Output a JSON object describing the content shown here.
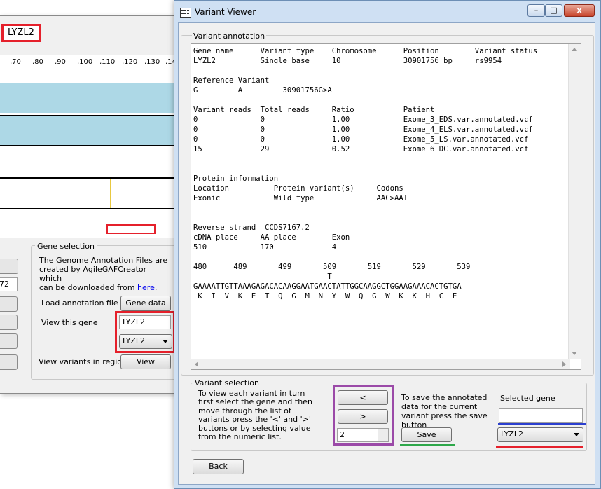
{
  "background_window": {
    "gene_label": "LYZL2",
    "ruler_ticks": [
      ",70",
      ",80",
      ",90",
      ",100",
      ",110",
      ",120",
      ",130",
      ",14"
    ],
    "left_field_value": "72",
    "gene_selection": {
      "title": "Gene selection",
      "info_line1": "The Genome Annotation Files are",
      "info_line2": "created by AgileGAFCreator which",
      "info_line3": "can be downloaded from ",
      "info_link": "here",
      "info_line3_end": ".",
      "load_annotation_label": "Load annotation file",
      "gene_data_button": "Gene data",
      "view_gene_label": "View this gene",
      "gene_text_value": "LYZL2",
      "gene_combo_value": "LYZL2",
      "view_region_label": "View variants in region",
      "view_button": "View"
    }
  },
  "window": {
    "title": "Variant Viewer",
    "minimize": "–",
    "maximize": "□",
    "close": "x"
  },
  "annotation": {
    "group_title": "Variant annotation",
    "lines": [
      "Gene name      Variant type    Chromosome      Position        Variant status",
      "LYZL2          Single base     10              30901756 bp     rs9954",
      "",
      "Reference Variant",
      "G         A         30901756G>A",
      "",
      "Variant reads  Total reads     Ratio           Patient",
      "0              0               1.00            Exome_3_EDS.var.annotated.vcf",
      "0              0               1.00            Exome_4_ELS.var.annotated.vcf",
      "0              0               1.00            Exome_5_LS.var.annotated.vcf",
      "15             29              0.52            Exome_6_DC.var.annotated.vcf",
      "",
      "",
      "Protein information",
      "Location          Protein variant(s)     Codons",
      "Exonic            Wild type              AAC>AAT",
      "",
      "",
      "Reverse strand  CCDS7167.2",
      "cDNA place     AA place        Exon",
      "510            170             4",
      "",
      "480      489       499       509       519       529       539",
      "                              T",
      "GAAAATTGTTAAAGAGACACAAGGAATGAACTATTGGCAAGGCTGGAAGAAACACTGTGA",
      " K  I  V  K  E  T  Q  G  M  N  Y  W  Q  G  W  K  K  H  C  E"
    ]
  },
  "variant_selection": {
    "group_title": "Variant selection",
    "instructions": "To view each variant in turn first select the gene and then move through the list of variants press the '<' and '>' buttons or by selecting value from the numeric list.",
    "prev_button": "<",
    "next_button": ">",
    "variant_number": "2",
    "save_note": "To save the annotated data for the current variant press the save button",
    "save_button": "Save",
    "selected_gene_label": "Selected gene",
    "selected_gene_text": "",
    "selected_gene_combo": "LYZL2"
  },
  "back_button": "Back",
  "colors": {
    "highlight_red": "#e5202b",
    "highlight_purple": "#9b4aa8",
    "highlight_green": "#2ea84a",
    "highlight_blue": "#2b3fcf",
    "track_blue": "#add8e6"
  }
}
